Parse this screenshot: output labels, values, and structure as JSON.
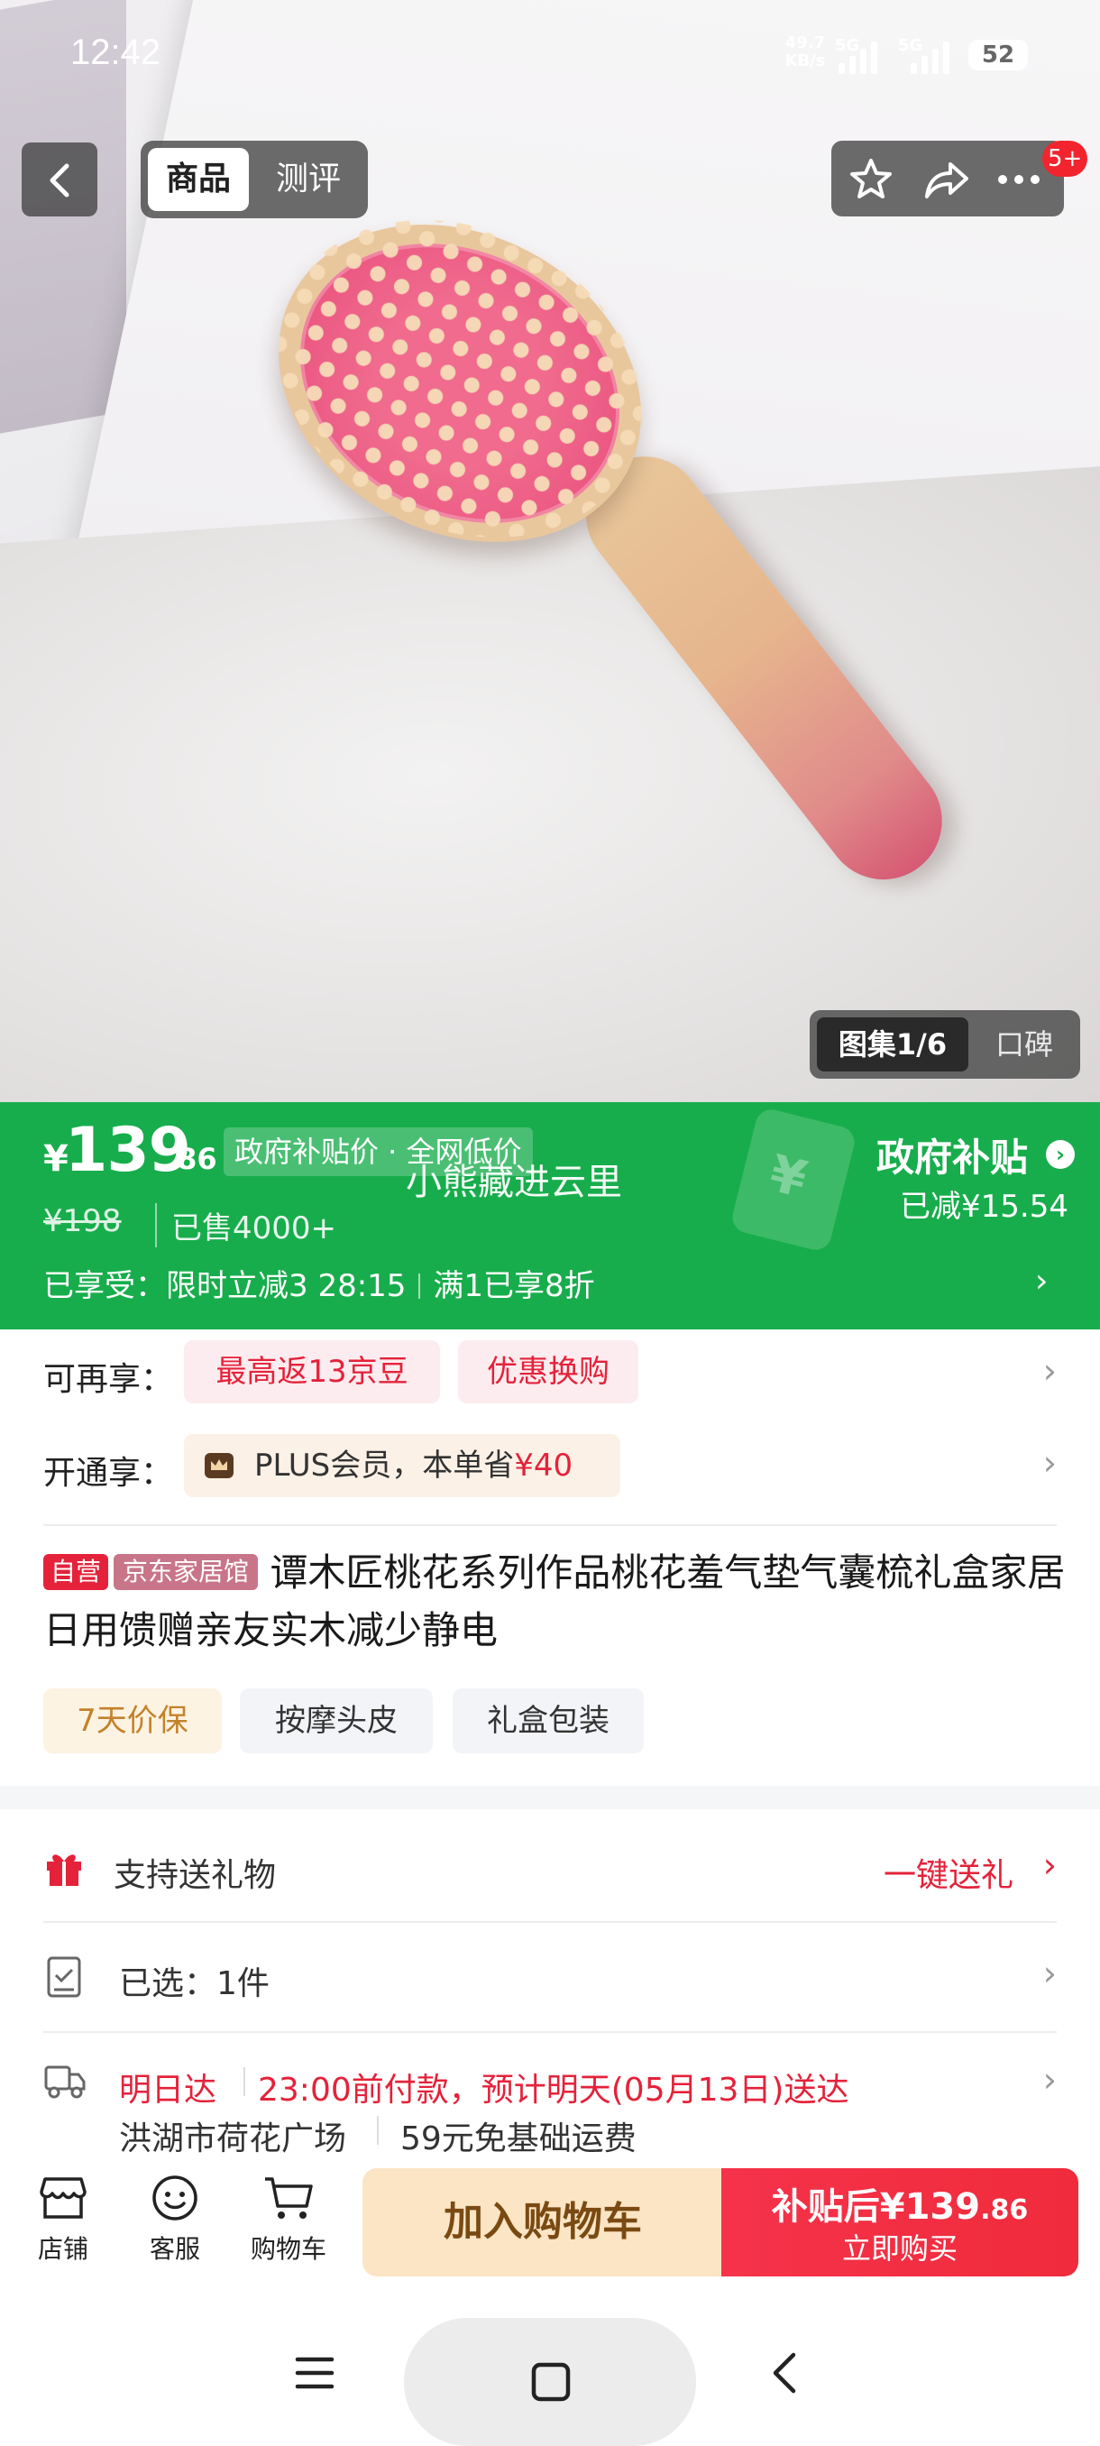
{
  "status_bar": {
    "time": "12:42",
    "net_speed_value": "49.7",
    "net_speed_unit": "KB/s",
    "sig1": "5G",
    "sig2": "5G",
    "battery": "52"
  },
  "nav": {
    "tab_product": "商品",
    "tab_review": "测评",
    "cart_badge": "5+"
  },
  "gallery": {
    "album_label": "图集1/6",
    "reputation_label": "口碑"
  },
  "price": {
    "currency": "¥",
    "integer": "139",
    "decimal": ".86",
    "gov_price_tag": "政府补贴价 · 全网低价",
    "watermark": "小熊藏进云里",
    "original_price": "¥198",
    "sold": "已售4000+",
    "gov_title": "政府补贴",
    "gov_saved": "已减¥15.54",
    "enjoy_label": "已享受：",
    "enjoy_item1": "限时立减3 28:15",
    "enjoy_item2": "满1已享8折"
  },
  "perks": {
    "more_label": "可再享：",
    "coupon1": "最高返13京豆",
    "coupon2": "优惠换购",
    "plus_label": "开通享：",
    "plus_text_prefix": "PLUS会员，本单省",
    "plus_amount": "¥40"
  },
  "product": {
    "tag_self": "自营",
    "tag_shop": "京东家居馆",
    "title": "谭木匠桃花系列作品桃花羞气垫气囊梳礼盒家居日用馈赠亲友实木减少静电",
    "features": [
      "7天价保",
      "按摩头皮",
      "礼盒包装"
    ]
  },
  "service_rows": {
    "gift_label": "支持送礼物",
    "gift_action": "一键送礼",
    "selected_label": "已选：1件",
    "delivery_speed": "明日达",
    "delivery_detail": "23:00前付款，预计明天(05月13日)送达",
    "address": "洪湖市荷花广场",
    "shipping": "59元免基础运费"
  },
  "bottom_bar": {
    "store": "店铺",
    "service": "客服",
    "cart": "购物车",
    "add_to_cart": "加入购物车",
    "buy_price_prefix": "补贴后¥",
    "buy_price_int": "139",
    "buy_price_dec": ".86",
    "buy_now": "立即购买"
  },
  "colors": {
    "green_band": "#18ad4c",
    "accent_red": "#e4223a",
    "cart_button": "#fbe5c4",
    "buy_button": "#f5324a"
  }
}
